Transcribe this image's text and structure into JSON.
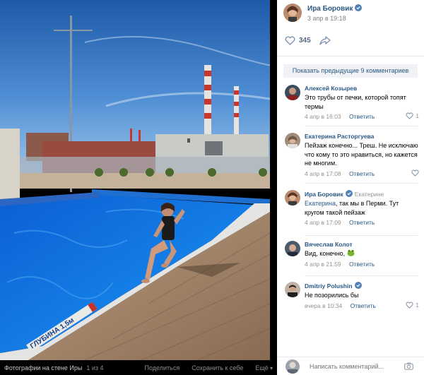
{
  "viewer": {
    "album_label": "Фотографии на стене Иры",
    "counter": "1 из 4",
    "actions": {
      "share": "Поделиться",
      "save": "Сохранить к себе",
      "more": "Ещё"
    },
    "photo": {
      "pool_sign": "ГЛУБИНА 1,5м"
    }
  },
  "post": {
    "author": "Ира Боровик",
    "date": "3 апр в 19:18",
    "likes": "345",
    "show_previous": "Показать предыдущие 9 комментариев"
  },
  "comments": [
    {
      "name": "Алексей Козырев",
      "text": "Это трубы от печки, которой топят термы",
      "date": "4 апр в 16:03",
      "reply_label": "Ответить",
      "likes": "1"
    },
    {
      "name": "Екатерина Расторгуева",
      "text": "Пейзаж конечно... Треш. Не исключаю что кому то это нравиться, но кажется не многим.",
      "date": "4 апр в 17:08",
      "reply_label": "Ответить",
      "likes": ""
    },
    {
      "name": "Ира Боровик",
      "reply_to": "Екатерине",
      "mention": "Екатерина",
      "text": ", так мы в Перми. Тут кругом такой пейзаж",
      "date": "4 апр в 17:09",
      "reply_label": "Ответить",
      "likes": ""
    },
    {
      "name": "Вячеслав Колот",
      "text": "Вид, конечно,",
      "date": "4 апр в 21:59",
      "reply_label": "Ответить",
      "likes": ""
    },
    {
      "name": "Dmitriy Polushin",
      "text": "Не позорились бы",
      "date": "вчера в 10:34",
      "reply_label": "Ответить",
      "likes": "1"
    }
  ],
  "composer": {
    "placeholder": "Написать комментарий..."
  },
  "colors": {
    "link": "#2a5885",
    "muted": "#939393",
    "verified": "#5181b8"
  }
}
